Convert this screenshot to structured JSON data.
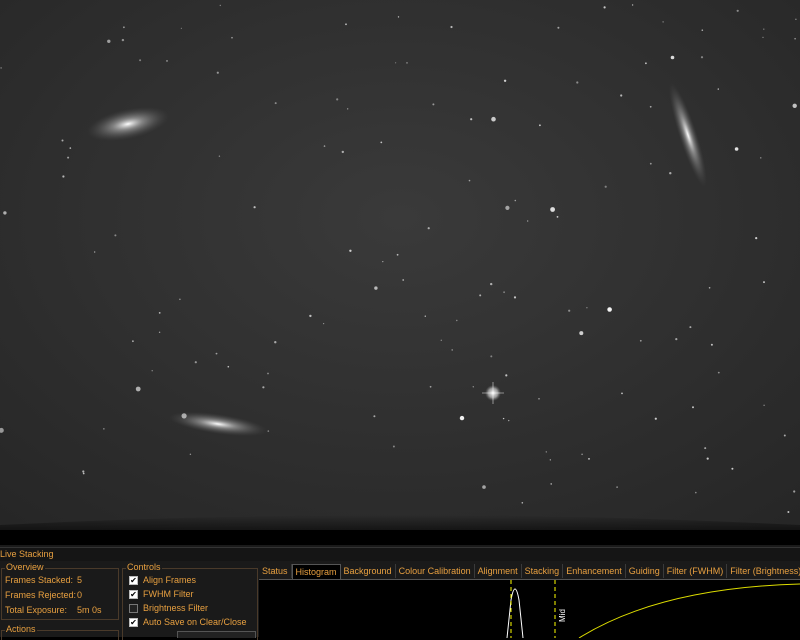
{
  "window": {
    "title": "Live Stacking"
  },
  "overview": {
    "label": "Overview",
    "rows": [
      {
        "label": "Frames Stacked:",
        "value": "5"
      },
      {
        "label": "Frames Rejected:",
        "value": "0"
      },
      {
        "label": "Total Exposure:",
        "value": "5m 0s"
      }
    ]
  },
  "actions": {
    "label": "Actions"
  },
  "controls": {
    "label": "Controls",
    "options": [
      {
        "label": "Align Frames",
        "checked": true
      },
      {
        "label": "FWHM Filter",
        "checked": true
      },
      {
        "label": "Brightness Filter",
        "checked": false
      },
      {
        "label": "Auto Save on Clear/Close",
        "checked": true
      }
    ]
  },
  "tabs": [
    {
      "label": "Status"
    },
    {
      "label": "Histogram",
      "active": true
    },
    {
      "label": "Background"
    },
    {
      "label": "Colour Calibration"
    },
    {
      "label": "Alignment"
    },
    {
      "label": "Stacking"
    },
    {
      "label": "Enhancement"
    },
    {
      "label": "Guiding"
    },
    {
      "label": "Filter (FWHM)"
    },
    {
      "label": "Filter (Brightness)"
    }
  ],
  "histogram": {
    "mid_label": "Mid"
  },
  "colors": {
    "accent": "#e8a040",
    "panel": "#1a1a1a",
    "marker": "#ffff00"
  }
}
